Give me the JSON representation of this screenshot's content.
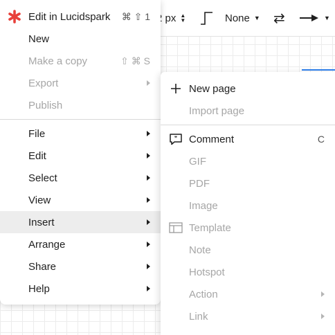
{
  "toolbar": {
    "stroke_width": "2 px",
    "endpoint_value": "None"
  },
  "main_menu": {
    "lucidspark": {
      "label": "Edit in Lucidspark",
      "shortcut": "⌘ ⇧ 1",
      "icon": "lucidspark-logo-icon"
    },
    "items": [
      {
        "label": "New",
        "disabled": false
      },
      {
        "label": "Make a copy",
        "disabled": true,
        "shortcut": "⇧ ⌘ S"
      },
      {
        "label": "Export",
        "disabled": true,
        "submenu": true
      },
      {
        "label": "Publish",
        "disabled": true
      },
      {
        "label": "File",
        "submenu": true
      },
      {
        "label": "Edit",
        "submenu": true
      },
      {
        "label": "Select",
        "submenu": true
      },
      {
        "label": "View",
        "submenu": true
      },
      {
        "label": "Insert",
        "submenu": true,
        "highlighted": true
      },
      {
        "label": "Arrange",
        "submenu": true
      },
      {
        "label": "Share",
        "submenu": true
      },
      {
        "label": "Help",
        "submenu": true
      }
    ]
  },
  "insert_menu": {
    "items": [
      {
        "label": "New page",
        "icon": "plus-icon"
      },
      {
        "label": "Import page",
        "disabled": true
      },
      {
        "label": "Comment",
        "icon": "comment-icon",
        "shortcut": "C"
      },
      {
        "label": "GIF",
        "disabled": true
      },
      {
        "label": "PDF",
        "disabled": true
      },
      {
        "label": "Image",
        "disabled": true
      },
      {
        "label": "Template",
        "disabled": true,
        "icon": "template-icon"
      },
      {
        "label": "Note",
        "disabled": true
      },
      {
        "label": "Hotspot",
        "disabled": true
      },
      {
        "label": "Action",
        "disabled": true,
        "submenu": true
      },
      {
        "label": "Link",
        "disabled": true,
        "submenu": true
      }
    ]
  },
  "colors": {
    "lucidspark_brand": "#e8403a",
    "disabled_text": "#a6a6a6",
    "highlight_bg": "#ededed",
    "selection_blue": "#2f80ed"
  }
}
